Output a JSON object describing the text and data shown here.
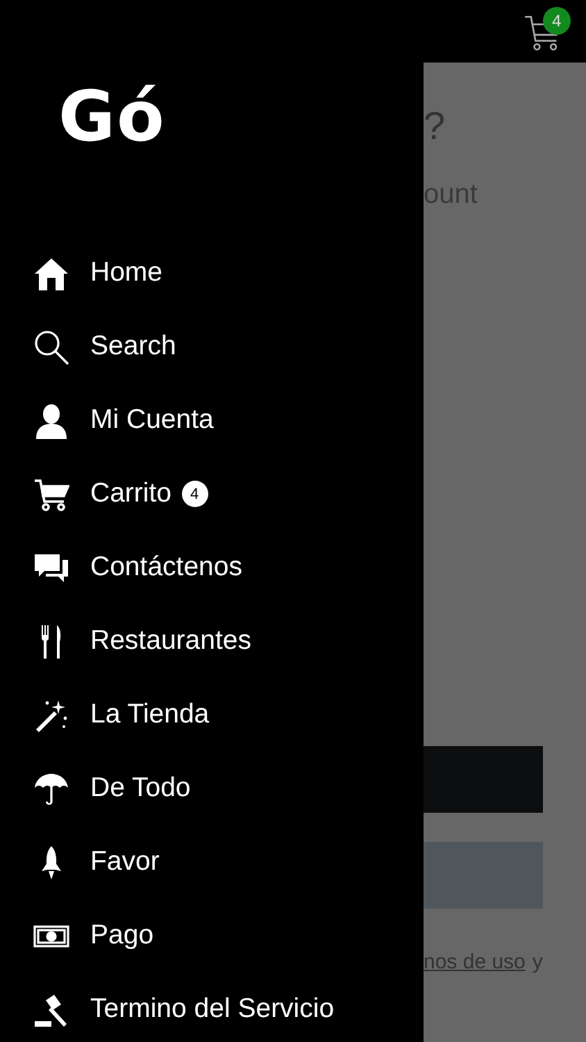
{
  "drawer": {
    "logo": "Gó",
    "menu": [
      {
        "label": "Home"
      },
      {
        "label": "Search"
      },
      {
        "label": "Mi Cuenta"
      },
      {
        "label": "Carrito",
        "badge": "4"
      },
      {
        "label": "Contáctenos"
      },
      {
        "label": "Restaurantes"
      },
      {
        "label": "La Tienda"
      },
      {
        "label": "De Todo"
      },
      {
        "label": "Favor"
      },
      {
        "label": "Pago"
      },
      {
        "label": "Termino del Servicio"
      }
    ]
  },
  "background": {
    "cart_badge": "4",
    "heading": "?",
    "subheading": "ount",
    "terms_link": "nos de uso",
    "terms_tail": "y"
  }
}
